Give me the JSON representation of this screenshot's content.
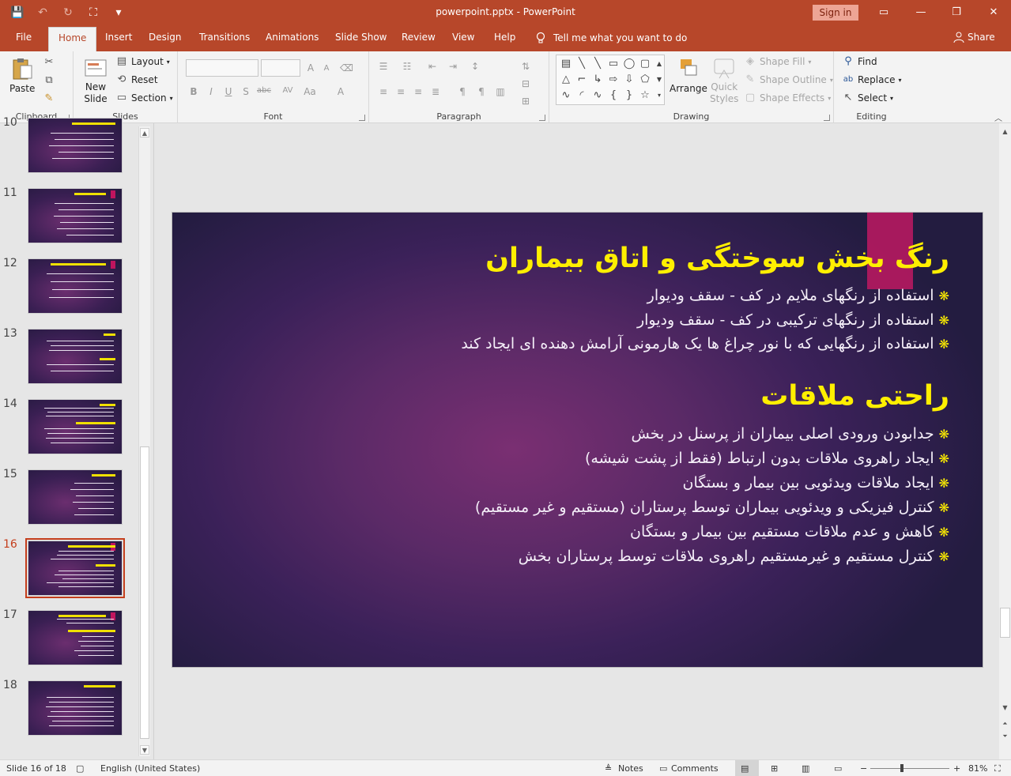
{
  "window": {
    "document_title": "powerpoint.pptx  -  PowerPoint",
    "sign_in": "Sign in",
    "minimize_icon": "—",
    "restore_icon": "❐",
    "close_icon": "✕",
    "ribbon_display_icon": "▭"
  },
  "qat": {
    "save": "💾",
    "undo": "↶",
    "redo": "↻",
    "present": "⛶",
    "customize": "▾"
  },
  "tabs": {
    "file": "File",
    "home": "Home",
    "insert": "Insert",
    "design": "Design",
    "transitions": "Transitions",
    "animations": "Animations",
    "slide_show": "Slide Show",
    "review": "Review",
    "view": "View",
    "help": "Help",
    "tell_me": "Tell me what you want to do",
    "share": "Share"
  },
  "ribbon": {
    "clipboard": {
      "title": "Clipboard",
      "paste": "Paste"
    },
    "slides": {
      "title": "Slides",
      "new_slide_1": "New",
      "new_slide_2": "Slide",
      "layout": "Layout",
      "reset": "Reset",
      "section": "Section"
    },
    "font": {
      "title": "Font",
      "bold": "B",
      "italic": "I",
      "underline": "U",
      "shadow": "S",
      "strike": "abc",
      "spacing": "AV",
      "case": "Aa",
      "color": "A",
      "grow": "A",
      "shrink": "A"
    },
    "paragraph": {
      "title": "Paragraph"
    },
    "drawing": {
      "title": "Drawing",
      "arrange": "Arrange",
      "quick_styles_1": "Quick",
      "quick_styles_2": "Styles",
      "shape_fill": "Shape Fill",
      "shape_outline": "Shape Outline",
      "shape_effects": "Shape Effects"
    },
    "editing": {
      "title": "Editing",
      "find": "Find",
      "replace": "Replace",
      "select": "Select"
    }
  },
  "thumbnails": [
    {
      "number": "10",
      "current": false
    },
    {
      "number": "11",
      "current": false
    },
    {
      "number": "12",
      "current": false
    },
    {
      "number": "13",
      "current": false
    },
    {
      "number": "14",
      "current": false
    },
    {
      "number": "15",
      "current": false
    },
    {
      "number": "16",
      "current": true
    },
    {
      "number": "17",
      "current": false
    },
    {
      "number": "18",
      "current": false
    }
  ],
  "slide": {
    "heading1": "رنگ بخش سوختگی و اتاق بیماران",
    "bullets1": [
      "استفاده از رنگهای ملایم در کف - سقف ودیوار",
      "استفاده از رنگهای ترکیبی در کف - سقف ودیوار",
      "استفاده از رنگهایی که با نور چراغ ها یک هارمونی آرامش دهنده ای ایجاد کند"
    ],
    "heading2": "راحتی ملاقات",
    "bullets2": [
      "جدابودن ورودی اصلی بیماران از پرسنل در بخش",
      "ایجاد راهروی ملاقات بدون ارتباط (فقط از پشت شیشه)",
      "ایجاد ملاقات ویدئویی بین بیمار و بستگان",
      "کنترل فیزیکی و ویدئویی بیماران توسط پرستاران (مستقیم و غیر مستقیم)",
      "کاهش و عدم ملاقات مستقیم بین بیمار و بستگان",
      "کنترل مستقیم و غیرمستقیم راهروی ملاقات توسط پرستاران بخش"
    ],
    "bullet_mark": "❋"
  },
  "status": {
    "slide_count": "Slide 16 of 18",
    "language": "English (United States)",
    "notes": "Notes",
    "comments": "Comments",
    "zoom": "81%",
    "zoom_minus": "−",
    "zoom_plus": "+"
  },
  "colors": {
    "accent": "#b7472a",
    "slide_title": "#ffef00",
    "slide_text": "#f4eef8",
    "slide_bar": "#b3195f"
  }
}
